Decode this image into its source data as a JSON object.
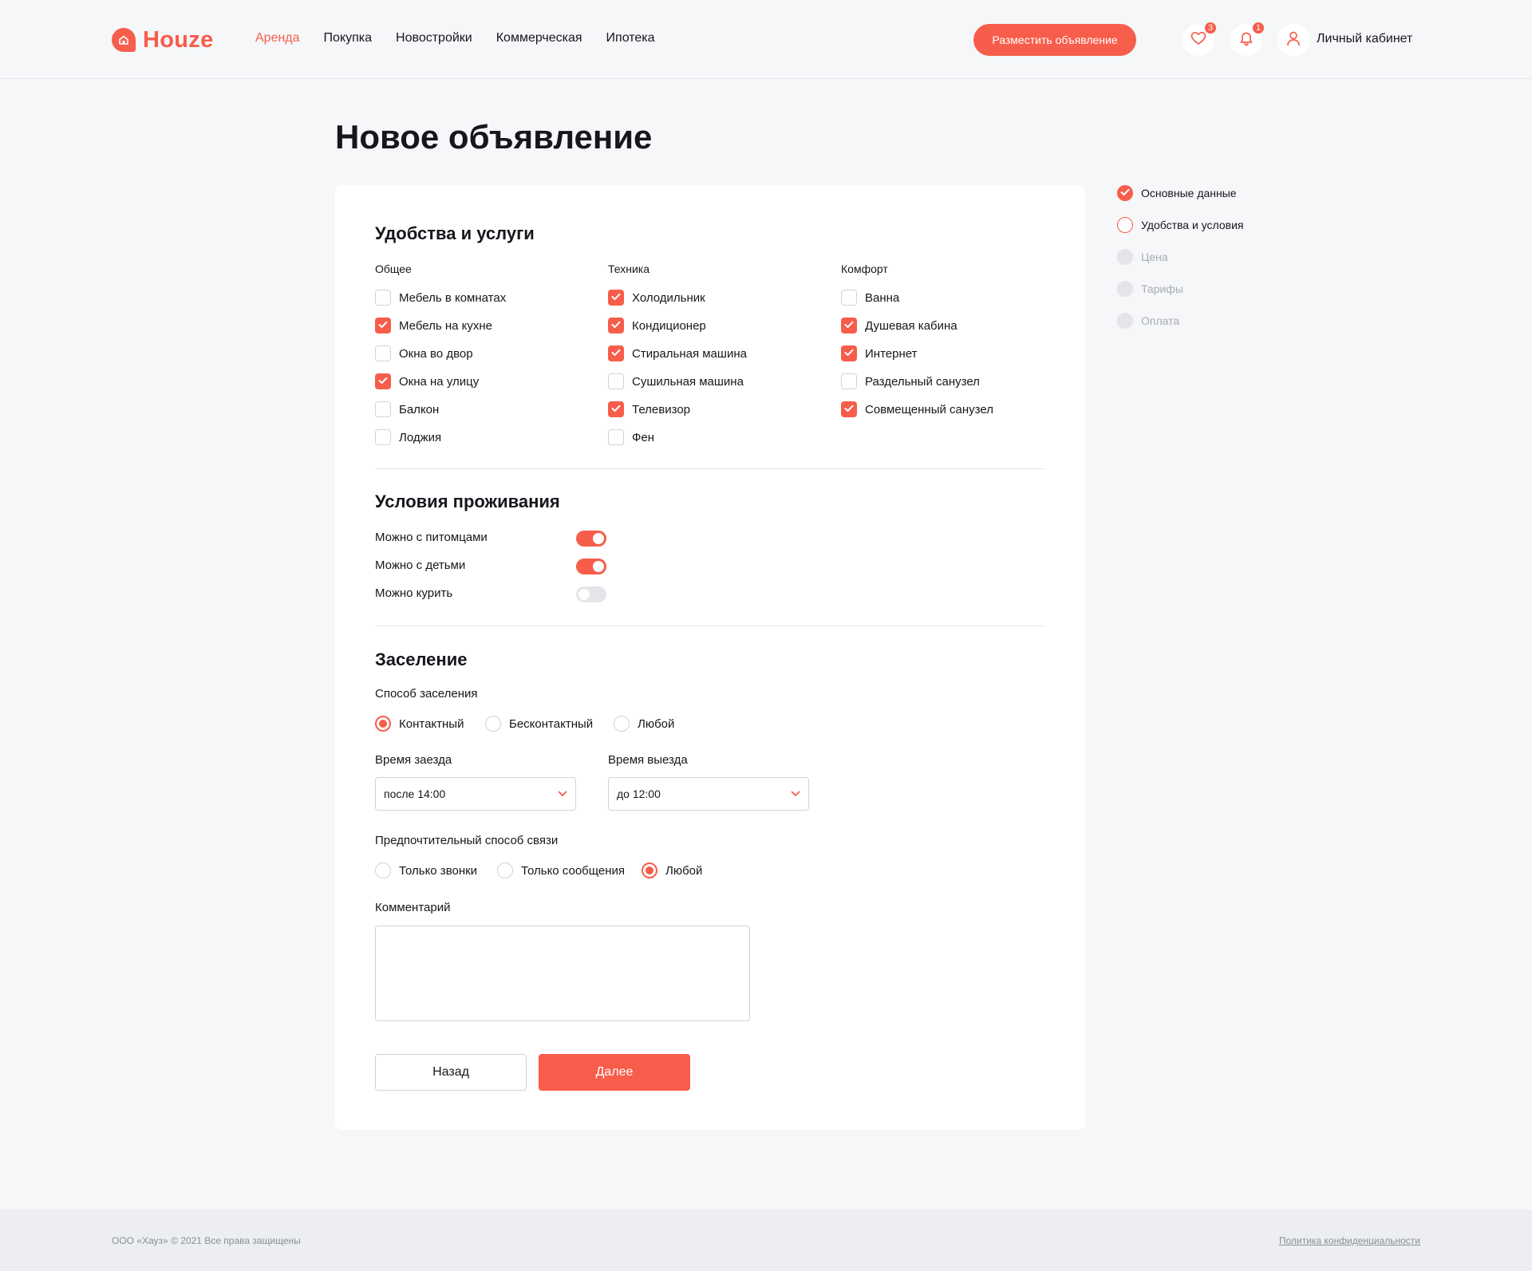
{
  "header": {
    "logo_text": "Houze",
    "nav": [
      "Аренда",
      "Покупка",
      "Новостройки",
      "Коммерческая",
      "Ипотека"
    ],
    "active_nav": "Аренда",
    "post_button": "Разместить объявление",
    "favorites_count": "3",
    "notifications_count": "1",
    "account_label": "Личный кабинет"
  },
  "page": {
    "title": "Новое объявление"
  },
  "amenities": {
    "title": "Удобства и услуги",
    "columns": [
      {
        "title": "Общее",
        "items": [
          {
            "label": "Мебель в комнатах",
            "checked": false
          },
          {
            "label": "Мебель на кухне",
            "checked": true
          },
          {
            "label": "Окна во двор",
            "checked": false
          },
          {
            "label": "Окна на улицу",
            "checked": true
          },
          {
            "label": "Балкон",
            "checked": false
          },
          {
            "label": "Лоджия",
            "checked": false
          }
        ]
      },
      {
        "title": "Техника",
        "items": [
          {
            "label": "Холодильник",
            "checked": true
          },
          {
            "label": "Кондиционер",
            "checked": true
          },
          {
            "label": "Стиральная машина",
            "checked": true
          },
          {
            "label": "Сушильная машина",
            "checked": false
          },
          {
            "label": "Телевизор",
            "checked": true
          },
          {
            "label": "Фен",
            "checked": false
          }
        ]
      },
      {
        "title": "Комфорт",
        "items": [
          {
            "label": "Ванна",
            "checked": false
          },
          {
            "label": "Душевая кабина",
            "checked": true
          },
          {
            "label": "Интернет",
            "checked": true
          },
          {
            "label": "Раздельный санузел",
            "checked": false
          },
          {
            "label": "Совмещенный санузел",
            "checked": true
          }
        ]
      }
    ]
  },
  "living": {
    "title": "Условия проживания",
    "toggles": [
      {
        "label": "Можно с питомцами",
        "on": true
      },
      {
        "label": "Можно с детьми",
        "on": true
      },
      {
        "label": "Можно курить",
        "on": false
      }
    ]
  },
  "checkin": {
    "title": "Заселение",
    "method_label": "Способ заселения",
    "methods": [
      {
        "label": "Контактный",
        "checked": true
      },
      {
        "label": "Бесконтактный",
        "checked": false
      },
      {
        "label": "Любой",
        "checked": false
      }
    ],
    "arrival_label": "Время заезда",
    "arrival_value": "после 14:00",
    "departure_label": "Время выезда",
    "departure_value": "до 12:00",
    "contact_label": "Предпочтительный способ связи",
    "contacts": [
      {
        "label": "Только звонки",
        "checked": false
      },
      {
        "label": "Только сообщения",
        "checked": false
      },
      {
        "label": "Любой",
        "checked": true
      }
    ],
    "comment_label": "Комментарий",
    "comment_value": ""
  },
  "buttons": {
    "back": "Назад",
    "next": "Далее"
  },
  "steps": [
    {
      "label": "Основные данные",
      "state": "done"
    },
    {
      "label": "Удобства и условия",
      "state": "current"
    },
    {
      "label": "Цена",
      "state": "pending"
    },
    {
      "label": "Тарифы",
      "state": "pending"
    },
    {
      "label": "Оплата",
      "state": "pending"
    }
  ],
  "footer": {
    "copyright": "ООО «Хауз» © 2021 Все права защищены",
    "privacy": "Политика конфиденциальности"
  },
  "colors": {
    "accent": "#F75D4B",
    "background": "#F6F7F9",
    "text": "#15171C",
    "muted": "#A8ABB2"
  }
}
